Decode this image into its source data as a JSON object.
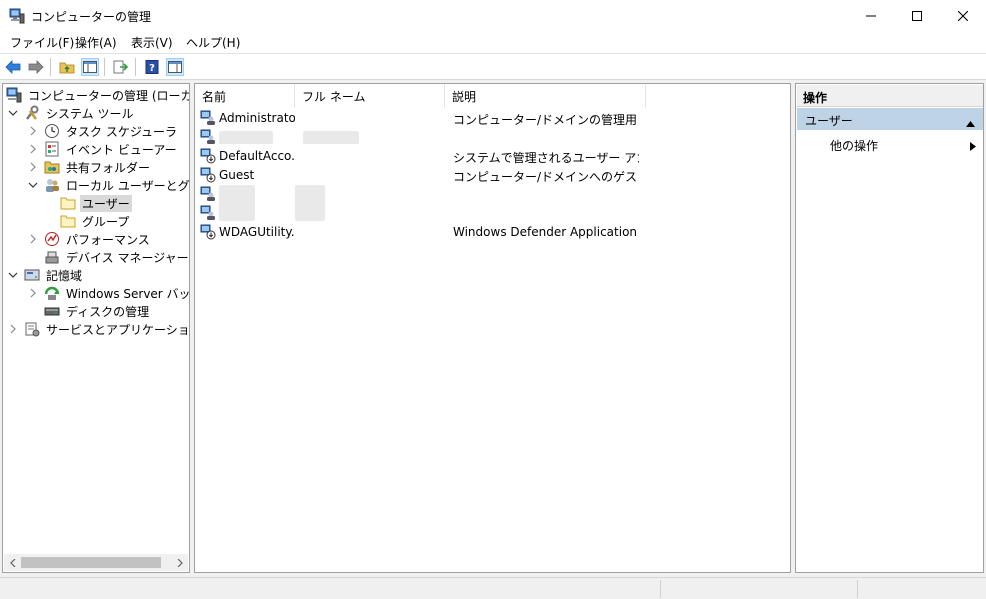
{
  "window": {
    "title": "コンピューターの管理"
  },
  "menu": [
    "ファイル(F)",
    "操作(A)",
    "表示(V)",
    "ヘルプ(H)"
  ],
  "toolbar": {
    "buttons": [
      "back-icon",
      "forward-icon",
      "up-folder-icon",
      "show-hide-tree-icon",
      "export-list-icon",
      "help-icon",
      "show-hide-action-pane-icon"
    ]
  },
  "tree": {
    "root": "コンピューターの管理 (ローカル)",
    "system_tools": "システム ツール",
    "task_scheduler": "タスク スケジューラ",
    "event_viewer": "イベント ビューアー",
    "shared_folders": "共有フォルダー",
    "local_users_groups": "ローカル ユーザーとグループ",
    "users": "ユーザー",
    "groups": "グループ",
    "performance": "パフォーマンス",
    "device_manager": "デバイス マネージャー",
    "storage": "記憶域",
    "windows_server_backup": "Windows Server バックア",
    "disk_management": "ディスクの管理",
    "services_apps": "サービスとアプリケーション"
  },
  "list": {
    "columns": [
      "名前",
      "フル ネーム",
      "説明"
    ],
    "rows": [
      {
        "name": "Administrator",
        "full_name": "",
        "description": "コンピューター/ドメインの管理用 (ビルト..."
      },
      {
        "name": "",
        "full_name": "",
        "description": "",
        "redacted": true
      },
      {
        "name": "DefaultAcco...",
        "full_name": "",
        "description": "システムで管理されるユーザー アカウン..."
      },
      {
        "name": "Guest",
        "full_name": "",
        "description": "コンピューター/ドメインへのゲスト アクセ..."
      },
      {
        "name": "",
        "full_name": "",
        "description": "",
        "redacted": true
      },
      {
        "name": "",
        "full_name": "",
        "description": "",
        "redacted": true
      },
      {
        "name": "WDAGUtility...",
        "full_name": "",
        "description": "Windows Defender Application G..."
      }
    ]
  },
  "actions": {
    "header": "操作",
    "section": "ユーザー",
    "more": "他の操作"
  },
  "colors": {
    "selection_bg": "#d9d9d9",
    "action_section_bg": "#bfd3e6",
    "pressed_toolbar": "#cce8ff"
  }
}
